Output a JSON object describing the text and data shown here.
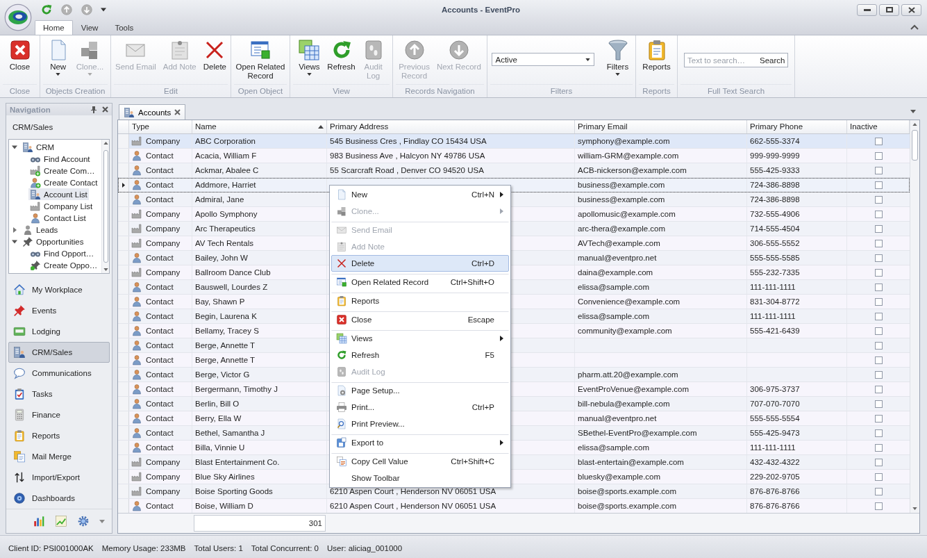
{
  "window": {
    "title": "Accounts - EventPro"
  },
  "ribbon_tabs": [
    {
      "label": "Home",
      "selected": true
    },
    {
      "label": "View",
      "selected": false
    },
    {
      "label": "Tools",
      "selected": false
    }
  ],
  "ribbon_groups": [
    {
      "kind": "buttons",
      "label": "Close",
      "buttons": [
        {
          "label": "Close",
          "disabled": false,
          "dropdown": false
        }
      ]
    },
    {
      "kind": "buttons",
      "label": "Objects Creation",
      "buttons": [
        {
          "label": "New",
          "disabled": false,
          "dropdown": true
        },
        {
          "label": "Clone...",
          "disabled": true,
          "dropdown": true
        }
      ]
    },
    {
      "kind": "buttons",
      "label": "Edit",
      "buttons": [
        {
          "label": "Send Email",
          "disabled": true,
          "dropdown": false
        },
        {
          "label": "Add Note",
          "disabled": true,
          "dropdown": false
        },
        {
          "label": "Delete",
          "disabled": false,
          "dropdown": false
        }
      ]
    },
    {
      "kind": "buttons",
      "label": "Open Object",
      "buttons": [
        {
          "label": "Open Related\nRecord",
          "disabled": false,
          "dropdown": false
        }
      ]
    },
    {
      "kind": "buttons",
      "label": "View",
      "buttons": [
        {
          "label": "Views",
          "disabled": false,
          "dropdown": true
        },
        {
          "label": "Refresh",
          "disabled": false,
          "dropdown": false
        },
        {
          "label": "Audit\nLog",
          "disabled": true,
          "dropdown": false
        }
      ]
    },
    {
      "kind": "buttons",
      "label": "Records Navigation",
      "buttons": [
        {
          "label": "Previous\nRecord",
          "disabled": true,
          "dropdown": false
        },
        {
          "label": "Next Record",
          "disabled": true,
          "dropdown": false
        }
      ]
    },
    {
      "kind": "filters",
      "label": "Filters",
      "select": {
        "value": "Active"
      },
      "buttons": [
        {
          "label": "Filters",
          "disabled": false,
          "dropdown": true
        }
      ]
    },
    {
      "kind": "buttons",
      "label": "Reports",
      "buttons": [
        {
          "label": "Reports",
          "disabled": false,
          "dropdown": false
        }
      ]
    },
    {
      "kind": "search",
      "label": "Full Text Search",
      "search": {
        "placeholder": "Text to search…",
        "button": "Search"
      }
    }
  ],
  "navigation": {
    "title": "Navigation",
    "section": "CRM/Sales",
    "tree": [
      {
        "label": "CRM",
        "expanded": true,
        "selected": false,
        "children": [
          {
            "label": "Find Account",
            "selected": false
          },
          {
            "label": "Create Com…",
            "selected": false
          },
          {
            "label": "Create Contact",
            "selected": false
          },
          {
            "label": "Account List",
            "selected": true
          },
          {
            "label": "Company List",
            "selected": false
          },
          {
            "label": "Contact List",
            "selected": false
          }
        ]
      },
      {
        "label": "Leads",
        "expanded": false,
        "selected": false
      },
      {
        "label": "Opportunities",
        "expanded": true,
        "selected": false,
        "children": [
          {
            "label": "Find Opport…",
            "selected": false
          },
          {
            "label": "Create Oppo…",
            "selected": false
          }
        ]
      }
    ],
    "buttons": [
      {
        "label": "My Workplace",
        "selected": false
      },
      {
        "label": "Events",
        "selected": false
      },
      {
        "label": "Lodging",
        "selected": false
      },
      {
        "label": "CRM/Sales",
        "selected": true
      },
      {
        "label": "Communications",
        "selected": false
      },
      {
        "label": "Tasks",
        "selected": false
      },
      {
        "label": "Finance",
        "selected": false
      },
      {
        "label": "Reports",
        "selected": false
      },
      {
        "label": "Mail Merge",
        "selected": false
      },
      {
        "label": "Import/Export",
        "selected": false
      },
      {
        "label": "Dashboards",
        "selected": false
      }
    ]
  },
  "document_tabs": [
    {
      "label": "Accounts",
      "selected": true
    }
  ],
  "table": {
    "columns": [
      {
        "label": "Type",
        "sorted": false
      },
      {
        "label": "Name",
        "sorted": true
      },
      {
        "label": "Primary Address",
        "sorted": false
      },
      {
        "label": "Primary Email",
        "sorted": false
      },
      {
        "label": "Primary Phone",
        "sorted": false
      },
      {
        "label": "Inactive",
        "sorted": false
      }
    ],
    "rows": [
      {
        "kind": "company",
        "type": "Company",
        "name": "ABC Corporation",
        "address": "545 Business Cres , Findlay CO 15434 USA",
        "email": "symphony@example.com",
        "phone": "662-555-3374",
        "inactive": false,
        "selected": false,
        "highlighted": true
      },
      {
        "kind": "contact",
        "type": "Contact",
        "name": "Acacia, William F",
        "address": "983 Business Ave , Halcyon NY 49786 USA",
        "email": "william-GRM@example.com",
        "phone": "999-999-9999",
        "inactive": false,
        "selected": false,
        "highlighted": false
      },
      {
        "kind": "contact",
        "type": "Contact",
        "name": "Ackmar, Abalee C",
        "address": "55 Scarcraft Road , Denver CO 94520 USA",
        "email": "ACB-nickerson@example.com",
        "phone": "555-425-9333",
        "inactive": false,
        "selected": false,
        "highlighted": false
      },
      {
        "kind": "contact",
        "type": "Contact",
        "name": "Addmore, Harriet",
        "email": "business@example.com",
        "phone": "724-386-8898",
        "inactive": false,
        "selected": true,
        "highlighted": false
      },
      {
        "kind": "contact",
        "type": "Contact",
        "name": "Admiral, Jane",
        "email": "business@example.com",
        "phone": "724-386-8898",
        "inactive": false,
        "selected": false,
        "highlighted": false
      },
      {
        "kind": "company",
        "type": "Company",
        "name": "Apollo Symphony",
        "email": "apollomusic@example.com",
        "phone": "732-555-4906",
        "inactive": false,
        "selected": false,
        "highlighted": false
      },
      {
        "kind": "company",
        "type": "Company",
        "name": "Arc Therapeutics",
        "email": "arc-thera@example.com",
        "phone": "714-555-4504",
        "inactive": false,
        "selected": false,
        "highlighted": false
      },
      {
        "kind": "company",
        "type": "Company",
        "name": "AV Tech Rentals",
        "email": "AVTech@example.com",
        "phone": "306-555-5552",
        "inactive": false,
        "selected": false,
        "highlighted": false
      },
      {
        "kind": "contact",
        "type": "Contact",
        "name": "Bailey, John W",
        "email": "manual@eventpro.net",
        "phone": "555-555-5585",
        "inactive": false,
        "selected": false,
        "highlighted": false
      },
      {
        "kind": "company",
        "type": "Company",
        "name": "Ballroom Dance Club",
        "email": "daina@example.com",
        "phone": "555-232-7335",
        "inactive": false,
        "selected": false,
        "highlighted": false
      },
      {
        "kind": "contact",
        "type": "Contact",
        "name": "Bauswell, Lourdes Z",
        "email": "elissa@sample.com",
        "phone": "111-111-1111",
        "inactive": false,
        "selected": false,
        "highlighted": false
      },
      {
        "kind": "contact",
        "type": "Contact",
        "name": "Bay, Shawn P",
        "email": "Convenience@example.com",
        "phone": "831-304-8772",
        "inactive": false,
        "selected": false,
        "highlighted": false
      },
      {
        "kind": "contact",
        "type": "Contact",
        "name": "Begin, Laurena K",
        "email": "elissa@sample.com",
        "phone": "111-111-1111",
        "inactive": false,
        "selected": false,
        "highlighted": false
      },
      {
        "kind": "contact",
        "type": "Contact",
        "name": "Bellamy, Tracey S",
        "email": "community@example.com",
        "phone": "555-421-6439",
        "inactive": false,
        "selected": false,
        "highlighted": false
      },
      {
        "kind": "contact",
        "type": "Contact",
        "name": "Berge, Annette T",
        "inactive": false,
        "selected": false,
        "highlighted": false
      },
      {
        "kind": "contact",
        "type": "Contact",
        "name": "Berge, Annette T",
        "inactive": false,
        "selected": false,
        "highlighted": false
      },
      {
        "kind": "contact",
        "type": "Contact",
        "name": "Berge, Victor G",
        "email": "pharm.att.20@example.com",
        "inactive": false,
        "selected": false,
        "highlighted": false
      },
      {
        "kind": "contact",
        "type": "Contact",
        "name": "Bergermann, Timothy J",
        "email": "EventProVenue@example.com",
        "phone": "306-975-3737",
        "inactive": false,
        "selected": false,
        "highlighted": false
      },
      {
        "kind": "contact",
        "type": "Contact",
        "name": "Berlin, Bill O",
        "email": "bill-nebula@example.com",
        "phone": "707-070-7070",
        "inactive": false,
        "selected": false,
        "highlighted": false
      },
      {
        "kind": "contact",
        "type": "Contact",
        "name": "Berry, Ella W",
        "email": "manual@eventpro.net",
        "phone": "555-555-5554",
        "inactive": false,
        "selected": false,
        "highlighted": false
      },
      {
        "kind": "contact",
        "type": "Contact",
        "name": "Bethel, Samantha J",
        "email": "SBethel-EventPro@example.com",
        "phone": "555-425-9473",
        "inactive": false,
        "selected": false,
        "highlighted": false
      },
      {
        "kind": "contact",
        "type": "Contact",
        "name": "Billa, Vinnie U",
        "email": "elissa@sample.com",
        "phone": "111-111-1111",
        "inactive": false,
        "selected": false,
        "highlighted": false
      },
      {
        "kind": "company",
        "type": "Company",
        "name": "Blast Entertainment Co.",
        "email": "blast-entertain@example.com",
        "phone": "432-432-4322",
        "inactive": false,
        "selected": false,
        "highlighted": false
      },
      {
        "kind": "company",
        "type": "Company",
        "name": "Blue Sky Airlines",
        "email": "bluesky@example.com",
        "phone": "229-202-9705",
        "inactive": false,
        "selected": false,
        "highlighted": false
      },
      {
        "kind": "company",
        "type": "Company",
        "name": "Boise Sporting Goods",
        "address": "6210 Aspen Court , Henderson NV 06051 USA",
        "email": "boise@sports.example.com",
        "phone": "876-876-8766",
        "inactive": false,
        "selected": false,
        "highlighted": false
      },
      {
        "kind": "contact",
        "type": "Contact",
        "name": "Boise, William D",
        "address": "6210 Aspen Court , Henderson NV 06051 USA",
        "email": "boise@sports.example.com",
        "phone": "876-876-8766",
        "inactive": false,
        "selected": false,
        "highlighted": false
      }
    ],
    "summary": "301"
  },
  "context_menu": {
    "items": [
      {
        "label": "New",
        "shortcut": "Ctrl+N",
        "submenu": true,
        "disabled": false,
        "selected": false,
        "separator_before": false
      },
      {
        "label": "Clone...",
        "submenu": true,
        "disabled": true,
        "selected": false,
        "separator_before": false
      },
      {
        "label": "Send Email",
        "submenu": false,
        "disabled": true,
        "selected": false,
        "separator_before": true
      },
      {
        "label": "Add Note",
        "submenu": false,
        "disabled": true,
        "selected": false,
        "separator_before": false
      },
      {
        "label": "Delete",
        "shortcut": "Ctrl+D",
        "submenu": false,
        "disabled": false,
        "selected": true,
        "separator_before": false
      },
      {
        "label": "Open Related Record",
        "shortcut": "Ctrl+Shift+O",
        "submenu": false,
        "disabled": false,
        "selected": false,
        "separator_before": true
      },
      {
        "label": "Reports",
        "submenu": false,
        "disabled": false,
        "selected": false,
        "separator_before": true
      },
      {
        "label": "Close",
        "shortcut": "Escape",
        "submenu": false,
        "disabled": false,
        "selected": false,
        "separator_before": true
      },
      {
        "label": "Views",
        "submenu": true,
        "disabled": false,
        "selected": false,
        "separator_before": true
      },
      {
        "label": "Refresh",
        "shortcut": "F5",
        "submenu": false,
        "disabled": false,
        "selected": false,
        "separator_before": false
      },
      {
        "label": "Audit Log",
        "submenu": false,
        "disabled": true,
        "selected": false,
        "separator_before": false
      },
      {
        "label": "Page Setup...",
        "submenu": false,
        "disabled": false,
        "selected": false,
        "separator_before": true
      },
      {
        "label": "Print...",
        "shortcut": "Ctrl+P",
        "submenu": false,
        "disabled": false,
        "selected": false,
        "separator_before": false
      },
      {
        "label": "Print Preview...",
        "submenu": false,
        "disabled": false,
        "selected": false,
        "separator_before": false
      },
      {
        "label": "Export to",
        "submenu": true,
        "disabled": false,
        "selected": false,
        "separator_before": true
      },
      {
        "label": "Copy Cell Value",
        "shortcut": "Ctrl+Shift+C",
        "submenu": false,
        "disabled": false,
        "selected": false,
        "separator_before": true
      },
      {
        "label": "Show Toolbar",
        "submenu": false,
        "disabled": false,
        "selected": false,
        "separator_before": false
      }
    ]
  },
  "status_bar": [
    "Client ID: PSI001000AK",
    "Memory Usage: 233MB",
    "Total Users: 1",
    "Total Concurrent: 0",
    "User: aliciag_001000"
  ]
}
